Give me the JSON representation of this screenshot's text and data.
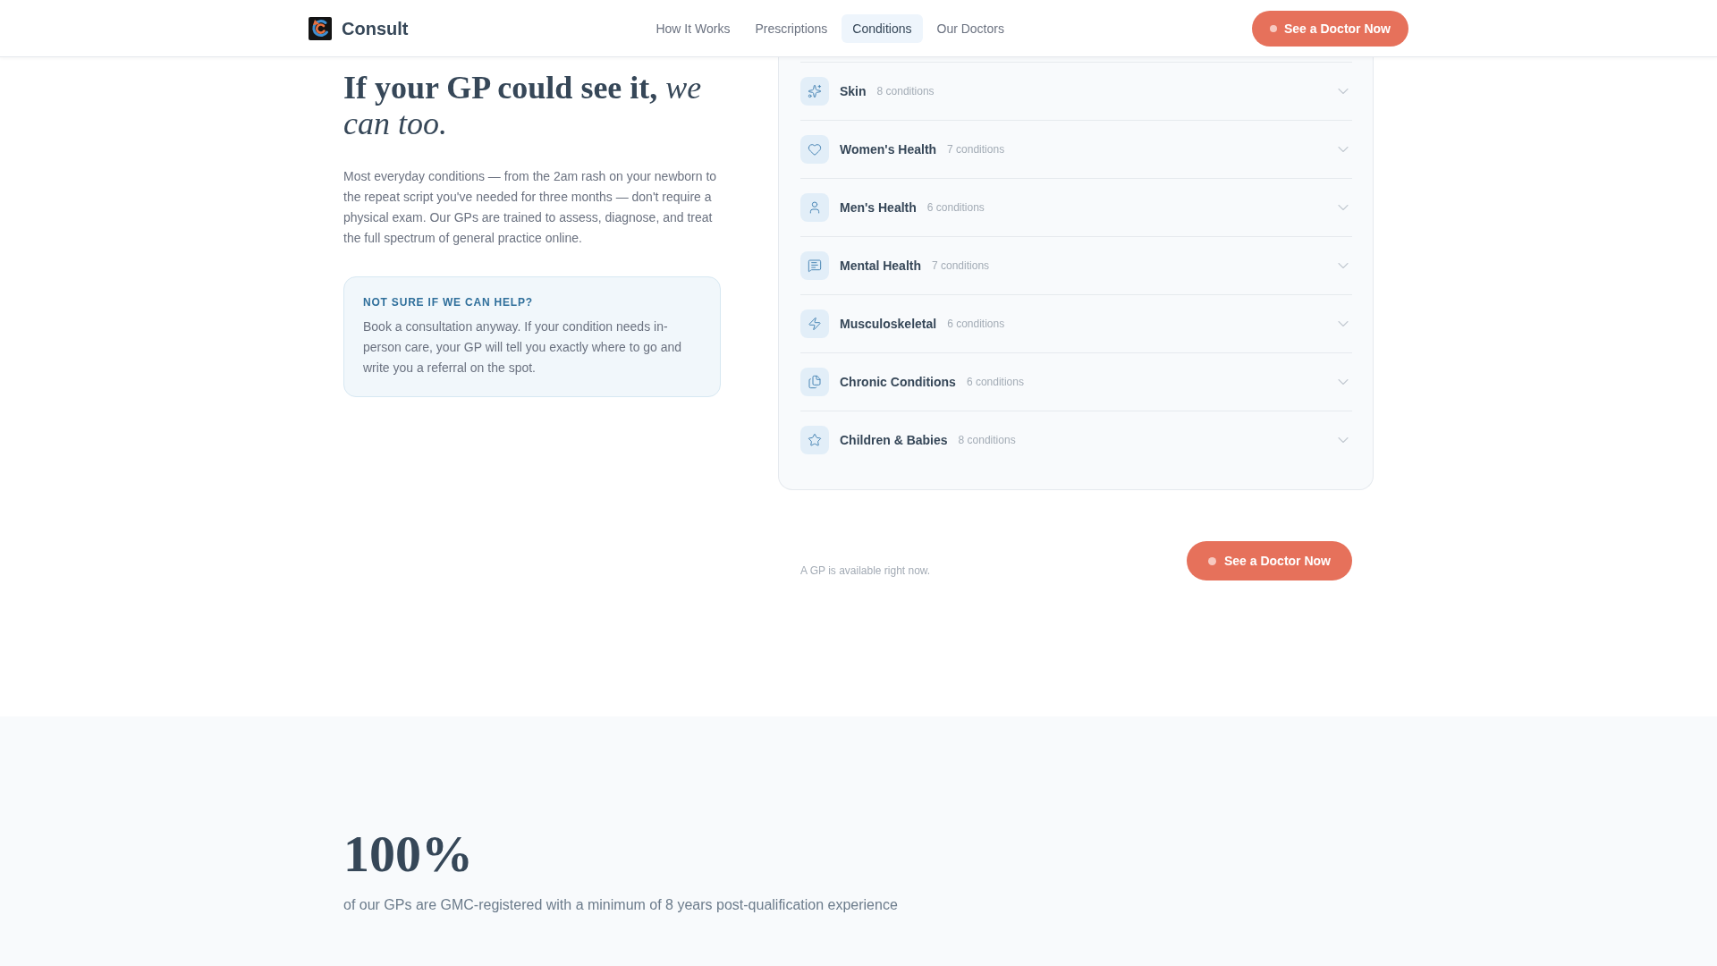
{
  "header": {
    "brand": "Consult",
    "nav": [
      {
        "label": "How It Works",
        "selected": false
      },
      {
        "label": "Prescriptions",
        "selected": false
      },
      {
        "label": "Conditions",
        "selected": true
      },
      {
        "label": "Our Doctors",
        "selected": false
      }
    ],
    "cta": {
      "label": "See a Doctor Now"
    }
  },
  "intro": {
    "heading": "If your GP could see it, *we can too.*",
    "body": "Most everyday conditions — from the 2am rash on your newborn to the repeat script you've needed for three months — don't require a physical exam. Our GPs are trained to assess, diagnose, and treat the full spectrum of general practice online.",
    "callout": {
      "title": "NOT SURE IF WE CAN HELP?",
      "body": "Book a consultation anyway. If your condition needs in-person care, your GP will tell you exactly where to go and write you a referral on the spot."
    }
  },
  "conditions": {
    "categories": [
      {
        "name": "Skin",
        "count": "8 conditions",
        "expanded": false
      },
      {
        "name": "Women's Health",
        "count": "7 conditions",
        "expanded": false
      },
      {
        "name": "Men's Health",
        "count": "6 conditions",
        "expanded": false
      },
      {
        "name": "Mental Health",
        "count": "7 conditions",
        "expanded": false
      },
      {
        "name": "Musculoskeletal",
        "count": "6 conditions",
        "expanded": false
      },
      {
        "name": "Chronic Conditions",
        "count": "6 conditions",
        "expanded": false
      },
      {
        "name": "Children & Babies",
        "count": "8 conditions",
        "expanded": false
      }
    ],
    "availability": "A GP is available right now.",
    "cta": {
      "label": "See a Doctor Now"
    }
  },
  "stat": {
    "value": "100%",
    "caption": "of our GPs are GMC-registered with a minimum of 8 years post-qualification experience"
  }
}
